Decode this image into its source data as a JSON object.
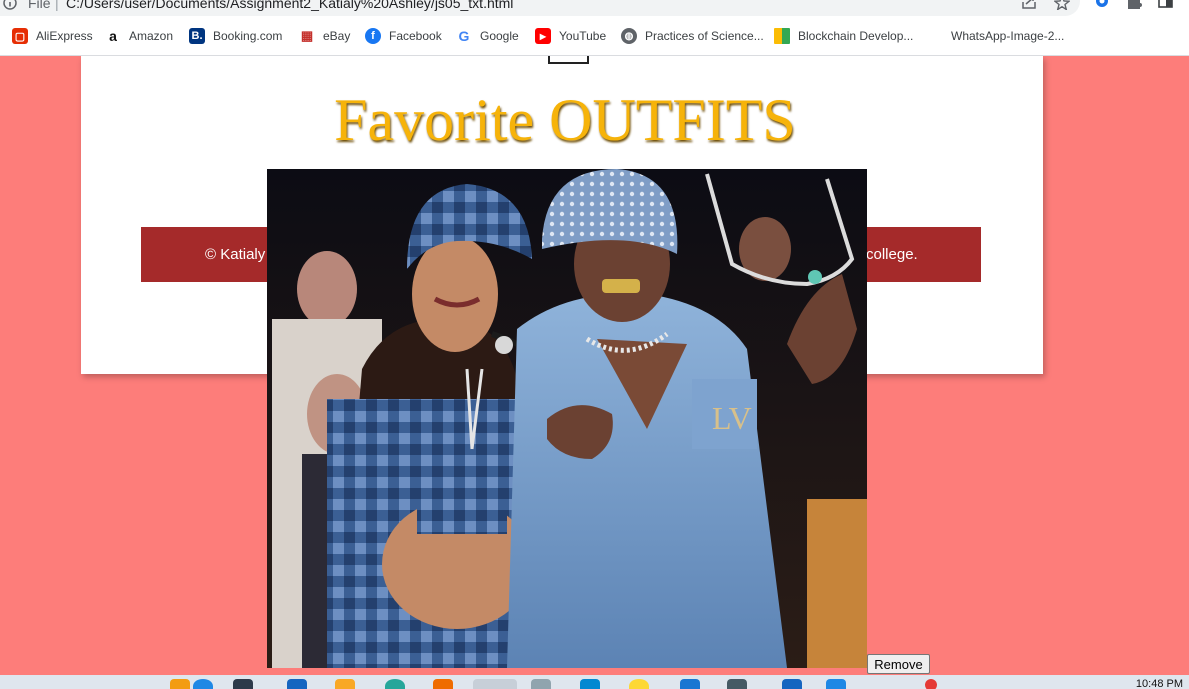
{
  "address_bar": {
    "file_label": "File",
    "separator": "|",
    "url": "C:/Users/user/Documents/Assignment2_Katialy%20Ashley/js05_txt.html"
  },
  "bookmarks": [
    {
      "label": "AliExpress",
      "icon": "aliexpress-icon"
    },
    {
      "label": "Amazon",
      "icon": "amazon-icon"
    },
    {
      "label": "Booking.com",
      "icon": "booking-icon"
    },
    {
      "label": "eBay",
      "icon": "ebay-icon"
    },
    {
      "label": "Facebook",
      "icon": "facebook-icon"
    },
    {
      "label": "Google",
      "icon": "google-icon"
    },
    {
      "label": "YouTube",
      "icon": "youtube-icon"
    },
    {
      "label": "Practices of Science...",
      "icon": "globe-icon"
    },
    {
      "label": "Blockchain Develop...",
      "icon": "grid-icon"
    },
    {
      "label": "WhatsApp-Image-2...",
      "icon": ""
    }
  ],
  "page": {
    "title": "Favorite OUTFITS",
    "footer_left": "© Katialy",
    "footer_right": "college.",
    "remove_button": "Remove"
  },
  "taskbar": {
    "clock": "10:48 PM"
  },
  "colors": {
    "page_background": "#fd7d7a",
    "title": "#f6b30a",
    "footer_bar": "#a52a2a"
  }
}
